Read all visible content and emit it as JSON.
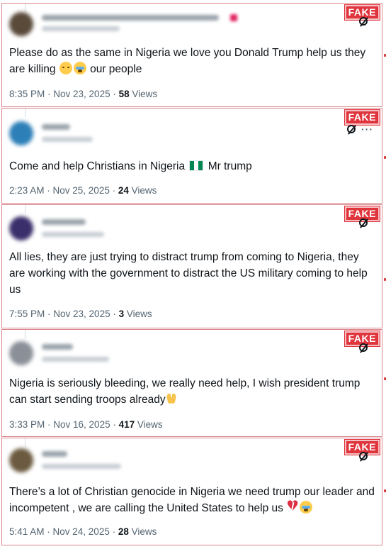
{
  "badge": "FAKE",
  "tweets": [
    {
      "text_a": "Please do as the same in Nigeria we love you Donald Trump help us they are killing ",
      "text_b": " our people",
      "time": "8:35 PM · Nov 23, 2025 · ",
      "views": "58",
      "views_label": " Views",
      "emojis": [
        "crying-face",
        "loudly-crying-face"
      ]
    },
    {
      "text_a": "Come and help Christians in Nigeria ",
      "text_b": " Mr trump",
      "time": "2:23 AM · Nov 25, 2025 · ",
      "views": "24",
      "views_label": " Views",
      "emojis": [
        "nigeria-flag"
      ]
    },
    {
      "text_a": "All lies, they are just trying to distract trump from coming to Nigeria, they are working with the government to distract the US military coming to help us",
      "time": "7:55 PM · Nov 23, 2025 · ",
      "views": "3",
      "views_label": " Views"
    },
    {
      "text_a": "Nigeria is seriously bleeding, we really need help, I wish president trump can start sending troops already",
      "time": "3:33 PM · Nov 16, 2025 · ",
      "views": "417",
      "views_label": " Views",
      "emojis": [
        "folded-hands"
      ]
    },
    {
      "text_a": "There’s a lot of Christian genocide in Nigeria we need trump our  leader and incompetent , we are calling the United States  to help us ",
      "time": "5:41 AM · Nov 24, 2025 · ",
      "views": "28",
      "views_label": " Views",
      "emojis": [
        "broken-heart",
        "loudly-crying-face"
      ]
    }
  ],
  "colors": {
    "fake_badge": "#e0353d",
    "border": "#d9868b",
    "meta_gray": "#536471"
  },
  "icons": [
    "grok-icon",
    "more-icon"
  ]
}
